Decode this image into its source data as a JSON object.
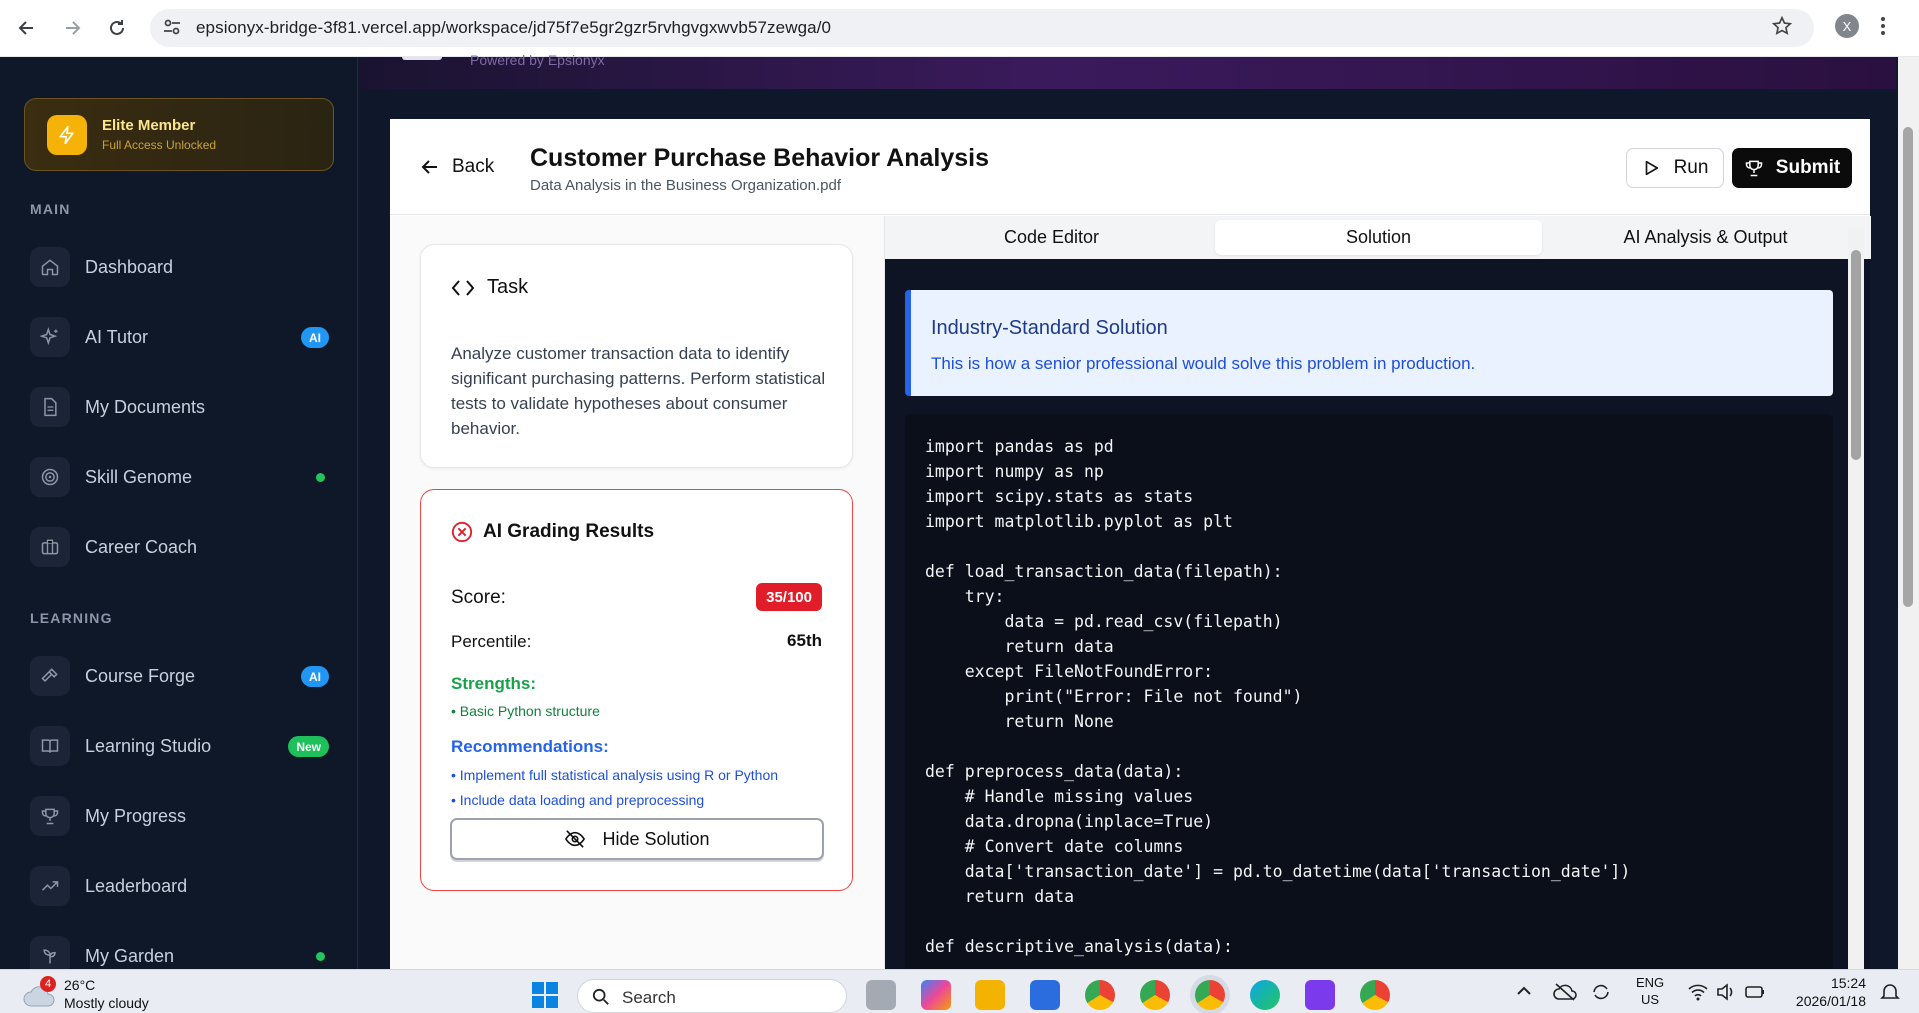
{
  "browser": {
    "url": "epsionyx-bridge-3f81.vercel.app/workspace/jd75f7e5gr2gzr5rvhgvgxwvb57zewga/0",
    "profile_initial": "X"
  },
  "header": {
    "powered_by": "Powered by Epsionyx"
  },
  "sidebar": {
    "elite": {
      "title": "Elite Member",
      "subtitle": "Full Access Unlocked"
    },
    "main_label": "MAIN",
    "learning_label": "LEARNING",
    "items": [
      {
        "label": "Dashboard",
        "icon": "home-icon"
      },
      {
        "label": "AI Tutor",
        "icon": "sparkles-icon",
        "badge": "AI"
      },
      {
        "label": "My Documents",
        "icon": "document-icon"
      },
      {
        "label": "Skill Genome",
        "icon": "target-icon"
      },
      {
        "label": "Career Coach",
        "icon": "briefcase-icon"
      },
      {
        "label": "Course Forge",
        "icon": "hammer-icon",
        "badge": "AI"
      },
      {
        "label": "Learning Studio",
        "icon": "book-icon",
        "badge": "New"
      },
      {
        "label": "My Progress",
        "icon": "trophy-icon"
      },
      {
        "label": "Leaderboard",
        "icon": "trending-up-icon"
      },
      {
        "label": "My Garden",
        "icon": "sprout-icon"
      }
    ]
  },
  "workspace": {
    "back_label": "Back",
    "title": "Customer Purchase Behavior Analysis",
    "subtitle": "Data Analysis in the Business Organization.pdf",
    "run_label": "Run",
    "submit_label": "Submit"
  },
  "task": {
    "heading": "Task",
    "description": "Analyze customer transaction data to identify significant purchasing patterns. Perform statistical tests to validate hypotheses about consumer behavior."
  },
  "grading": {
    "heading": "AI Grading Results",
    "score_label": "Score:",
    "score_value": "35/100",
    "percentile_label": "Percentile:",
    "percentile_value": "65th",
    "strengths_label": "Strengths:",
    "strengths": [
      "• Basic Python structure"
    ],
    "recommendations_label": "Recommendations:",
    "recommendations": [
      "• Implement full statistical analysis using R or Python",
      "• Include data loading and preprocessing"
    ],
    "hide_solution_label": "Hide Solution"
  },
  "tabs": [
    {
      "label": "Code Editor",
      "active": false
    },
    {
      "label": "Solution",
      "active": true
    },
    {
      "label": "AI Analysis & Output",
      "active": false
    }
  ],
  "solution": {
    "title": "Industry-Standard Solution",
    "description": "This is how a senior professional would solve this problem in production.",
    "code": "import pandas as pd\nimport numpy as np\nimport scipy.stats as stats\nimport matplotlib.pyplot as plt\n\ndef load_transaction_data(filepath):\n    try:\n        data = pd.read_csv(filepath)\n        return data\n    except FileNotFoundError:\n        print(\"Error: File not found\")\n        return None\n\ndef preprocess_data(data):\n    # Handle missing values\n    data.dropna(inplace=True)\n    # Convert date columns\n    data['transaction_date'] = pd.to_datetime(data['transaction_date'])\n    return data\n\ndef descriptive_analysis(data):"
  },
  "taskbar": {
    "weather_badge": "4",
    "temperature": "26°C",
    "condition": "Mostly cloudy",
    "search_placeholder": "Search",
    "lang_line1": "ENG",
    "lang_line2": "US",
    "time": "15:24",
    "date": "2026/01/18"
  }
}
